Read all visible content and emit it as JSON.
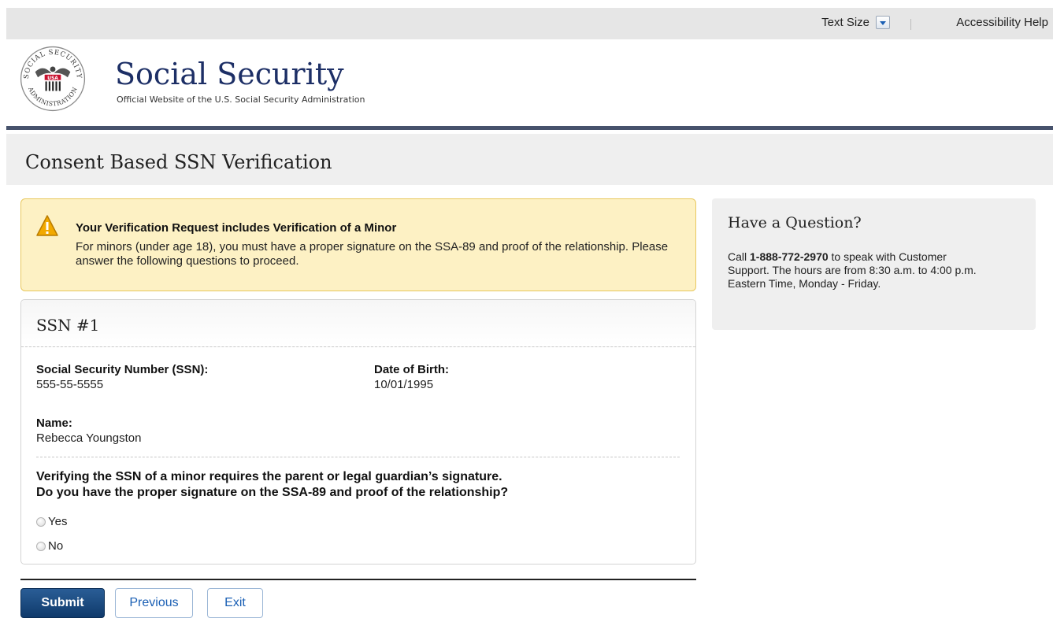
{
  "utility_bar": {
    "text_size_label": "Text Size",
    "accessibility_label": "Accessibility Help"
  },
  "header": {
    "site_title": "Social Security",
    "site_subtitle": "Official Website of the U.S. Social Security Administration",
    "seal_text": {
      "top": "SOCIAL SECURITY",
      "center": "USA",
      "bottom": "ADMINISTRATION"
    }
  },
  "page": {
    "title": "Consent Based SSN Verification"
  },
  "alert": {
    "icon": "warning-icon",
    "title": "Your Verification Request includes Verification of a Minor",
    "text": "For minors (under age 18), you must have a proper signature on the SSA-89 and proof of the relationship. Please answer the following questions to proceed."
  },
  "ssn_panel": {
    "heading": "SSN #1",
    "ssn_label": "Social Security Number (SSN):",
    "ssn_value": "555-55-5555",
    "dob_label": "Date of Birth:",
    "dob_value": "10/01/1995",
    "name_label": "Name:",
    "name_value": "Rebecca Youngston",
    "question_line1": "Verifying the SSN of a minor requires the parent or legal guardian’s signature.",
    "question_line2": "Do you have the proper signature on the SSA-89 and proof of the relationship?",
    "options": [
      {
        "label": "Yes"
      },
      {
        "label": "No"
      }
    ]
  },
  "actions": {
    "submit_label": "Submit",
    "previous_label": "Previous",
    "exit_label": "Exit"
  },
  "sidebar": {
    "heading": "Have a Question?",
    "text_before": "Call ",
    "phone": "1-888-772-2970",
    "text_after": " to speak with Customer Support. The hours are from 8:30 a.m. to 4:00 p.m. Eastern Time, Monday - Friday."
  },
  "colors": {
    "brand_navy": "#1d2f66",
    "header_rule": "#47526c",
    "alert_bg": "#fdf1c4",
    "alert_border": "#e8c85e",
    "primary_button": "#0f3a6b",
    "link_blue": "#1a5fb4"
  }
}
